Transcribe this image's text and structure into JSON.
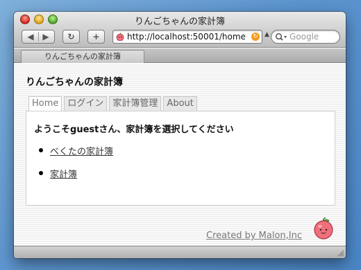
{
  "window": {
    "title": "りんごちゃんの家計簿"
  },
  "toolbar": {
    "back_icon": "◀",
    "forward_icon": "▶",
    "reload_icon": "↻",
    "add_icon": "+",
    "url": "http://localhost:50001/home",
    "search_placeholder": "Google"
  },
  "tab": {
    "label": "りんごちゃんの家計簿"
  },
  "page": {
    "site_title": "りんごちゃんの家計簿",
    "nav": [
      {
        "label": "Home"
      },
      {
        "label": "ログイン"
      },
      {
        "label": "家計簿管理"
      },
      {
        "label": "About"
      }
    ],
    "welcome": {
      "prefix": "ようこそ",
      "user": "guest",
      "suffix": "さん、家計簿を選択してください"
    },
    "books": [
      {
        "label": "べくたの家計簿"
      },
      {
        "label": "家計簿"
      }
    ],
    "footer": "Created by Malon,Inc"
  },
  "colors": {
    "desktop": "#5d95cf",
    "rss": "#f39a1e",
    "apple": "#ef6f7b"
  }
}
